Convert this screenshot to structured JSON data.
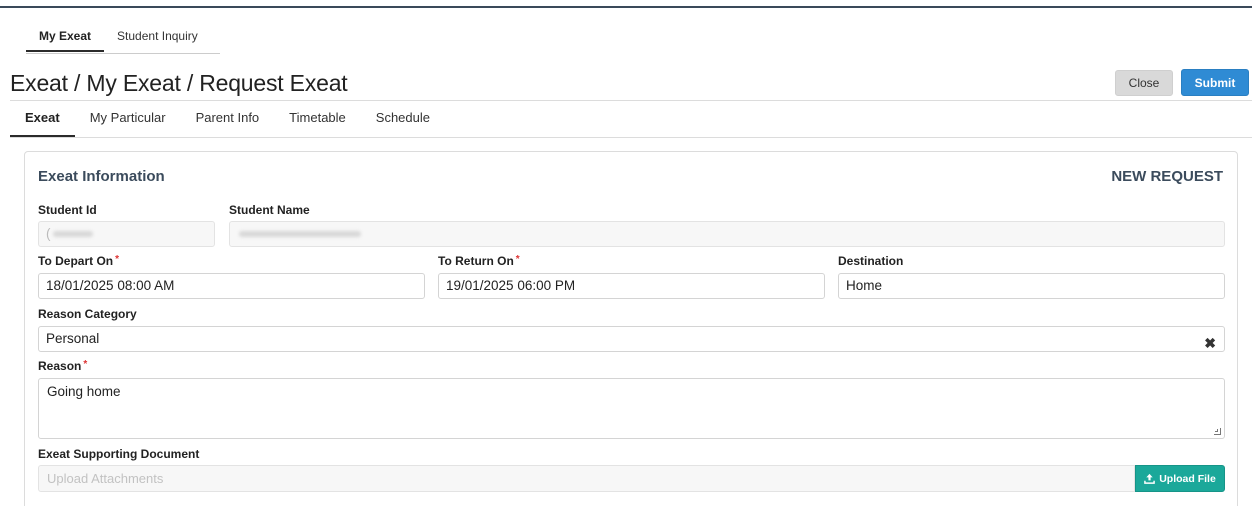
{
  "module_tabs": [
    {
      "label": "My Exeat",
      "active": true
    },
    {
      "label": "Student Inquiry",
      "active": false
    }
  ],
  "page_title": "Exeat / My Exeat / Request Exeat",
  "actions": {
    "close_label": "Close",
    "submit_label": "Submit"
  },
  "sub_tabs": [
    {
      "label": "Exeat",
      "active": true
    },
    {
      "label": "My Particular",
      "active": false
    },
    {
      "label": "Parent Info",
      "active": false
    },
    {
      "label": "Timetable",
      "active": false
    },
    {
      "label": "Schedule",
      "active": false
    }
  ],
  "panel": {
    "title": "Exeat Information",
    "status": "NEW REQUEST"
  },
  "fields": {
    "student_id_label": "Student Id",
    "student_id_value": "(",
    "student_name_label": "Student Name",
    "depart_label": "To Depart On",
    "depart_value": "18/01/2025 08:00 AM",
    "return_label": "To Return On",
    "return_value": "19/01/2025 06:00 PM",
    "destination_label": "Destination",
    "destination_value": "Home",
    "reason_category_label": "Reason Category",
    "reason_category_value": "Personal",
    "reason_label": "Reason",
    "reason_value": "Going home",
    "document_label": "Exeat Supporting Document",
    "document_placeholder": "Upload Attachments",
    "upload_label": "Upload File",
    "required_mark": "*"
  },
  "icons": {
    "clear": "close-x-icon",
    "upload": "upload-icon"
  },
  "colors": {
    "submit": "#2f8bd4",
    "upload": "#1ba89a",
    "required": "#dd3333"
  }
}
